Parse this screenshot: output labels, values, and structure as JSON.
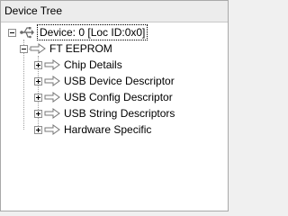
{
  "panel": {
    "title": "Device Tree"
  },
  "tree": {
    "root": {
      "label": "Device: 0 [Loc ID:0x0]",
      "icon": "usb-icon",
      "expanded": true,
      "children": [
        {
          "label": "FT EEPROM",
          "icon": "arrow-right-icon",
          "expanded": true,
          "children": [
            {
              "label": "Chip Details",
              "icon": "arrow-right-icon",
              "expanded": false
            },
            {
              "label": "USB Device Descriptor",
              "icon": "arrow-right-icon",
              "expanded": false
            },
            {
              "label": "USB Config Descriptor",
              "icon": "arrow-right-icon",
              "expanded": false
            },
            {
              "label": "USB String Descriptors",
              "icon": "arrow-right-icon",
              "expanded": false
            },
            {
              "label": "Hardware Specific",
              "icon": "arrow-right-icon",
              "expanded": false
            }
          ]
        }
      ]
    }
  }
}
